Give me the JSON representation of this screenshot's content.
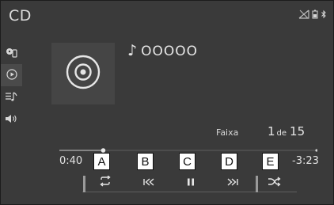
{
  "header": {
    "title": "CD"
  },
  "status_icons": [
    "no-signal-icon",
    "battery-icon",
    "bluetooth-icon"
  ],
  "sidebar": {
    "items": [
      {
        "icon": "source-media-icon",
        "active": false
      },
      {
        "icon": "play-circle-icon",
        "active": true
      },
      {
        "icon": "playlist-icon",
        "active": false
      },
      {
        "icon": "volume-icon",
        "active": false
      }
    ]
  },
  "now_playing": {
    "note": "♪",
    "track_title": "OOOOO",
    "track_label": "Faixa",
    "track_number": "1",
    "track_of": "de",
    "track_total": "15",
    "elapsed": "0:40",
    "remaining": "-3:23",
    "progress": 0.17
  },
  "controls": [
    {
      "callout": "A",
      "icon": "repeat-icon"
    },
    {
      "callout": "B",
      "icon": "previous-track-icon"
    },
    {
      "callout": "C",
      "icon": "pause-icon"
    },
    {
      "callout": "D",
      "icon": "next-track-icon"
    },
    {
      "callout": "E",
      "icon": "shuffle-icon"
    }
  ],
  "colors": {
    "screen_bg": "#3a3a3a",
    "text": "#e6e6e6",
    "callout_bg": "#ffffff"
  }
}
